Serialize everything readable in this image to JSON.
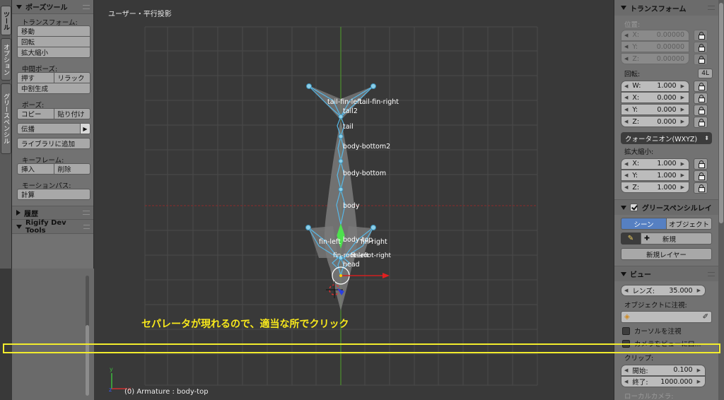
{
  "tab_strip": {
    "tabs": [
      "ツール",
      "オプション",
      "グリースペンシル"
    ]
  },
  "tool_shelf": {
    "pose_tools": {
      "title": "ポーズツール",
      "transform_label": "トランスフォーム:",
      "transform_buttons": [
        "移動",
        "回転",
        "拡大縮小"
      ],
      "inbetween_label": "中間ポーズ:",
      "push": "押す",
      "relax": "リラック",
      "breakdown": "中割生成",
      "pose_label": "ポーズ:",
      "copy": "コピー",
      "paste": "貼り付け",
      "propagate": "伝播",
      "add_to_library": "ライブラリに追加",
      "keyframe_label": "キーフレーム:",
      "insert": "挿入",
      "delete": "削除",
      "motion_path_label": "モーションパス:",
      "calculate": "計算"
    },
    "history": {
      "title": "履歴"
    },
    "rigify": {
      "title": "Rigify Dev Tools"
    }
  },
  "viewport": {
    "title": "ユーザー・平行投影",
    "status": "(0) Armature : body-top",
    "bones": [
      "tail-fin-left",
      "tail-fin-right",
      "tail2",
      "tail",
      "body-bottom2",
      "body-bottom",
      "body",
      "body-top",
      "fin-left",
      "fin-right",
      "fin-root-left",
      "fin-root-right",
      "head"
    ]
  },
  "annotation": {
    "caption": "セパレータが現れるので、適当な所でクリック",
    "color": "#f2ec2d"
  },
  "properties": {
    "transform": {
      "title": "トランスフォーム",
      "location_label": "位置:",
      "location": [
        {
          "axis": "X:",
          "value": "0.00000"
        },
        {
          "axis": "Y:",
          "value": "0.00000"
        },
        {
          "axis": "Z:",
          "value": "0.00000"
        }
      ],
      "rotation_label": "回転:",
      "rotation_badge": "4L",
      "rotation": [
        {
          "axis": "W:",
          "value": "1.000"
        },
        {
          "axis": "X:",
          "value": "0.000"
        },
        {
          "axis": "Y:",
          "value": "0.000"
        },
        {
          "axis": "Z:",
          "value": "0.000"
        }
      ],
      "rotation_mode": "クォータニオン(WXYZ)",
      "scale_label": "拡大縮小:",
      "scale": [
        {
          "axis": "X:",
          "value": "1.000"
        },
        {
          "axis": "Y:",
          "value": "1.000"
        },
        {
          "axis": "Z:",
          "value": "1.000"
        }
      ]
    },
    "grease_pencil": {
      "title": "グリースペンシルレイ",
      "scene": "シーン",
      "object": "オブジェクト",
      "new": "新規",
      "new_layer": "新規レイヤー"
    },
    "view": {
      "title": "ビュー",
      "lens_label": "レンズ:",
      "lens_value": "35.000",
      "lock_object_label": "オブジェクトに注視:",
      "lock_cursor": "カーソルを注視",
      "lock_camera": "カメラをビューに口...",
      "clip_label": "クリップ:",
      "clip_start_label": "開始:",
      "clip_start": "0.100",
      "clip_end_label": "終了:",
      "clip_end": "1000.000",
      "local_camera": "ローカルカメラ:"
    }
  },
  "colors": {
    "viewport_bg": "#393939",
    "panel_bg": "#727272",
    "bone_blue": "#57b8e8",
    "active_bone": "#4ee04e",
    "toggle_blue": "#5680c2"
  }
}
